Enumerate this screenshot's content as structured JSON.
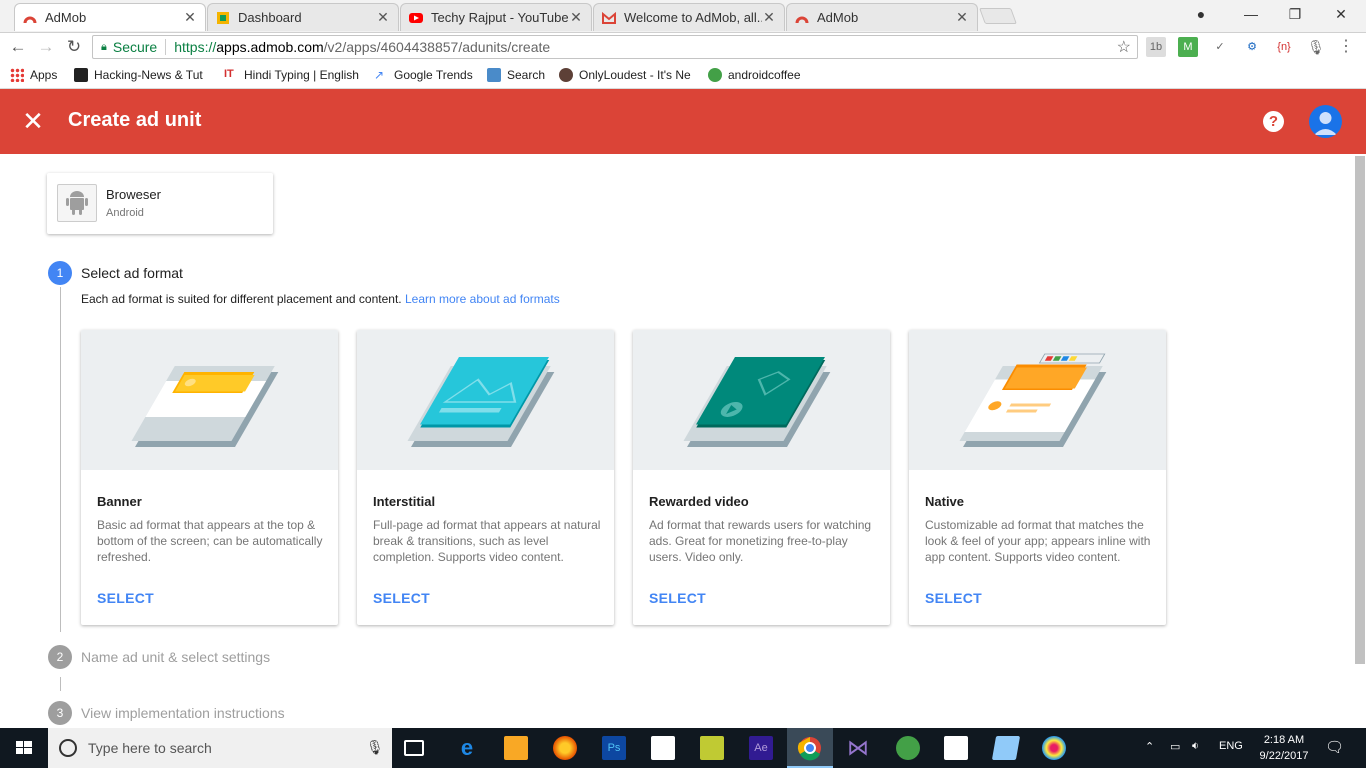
{
  "browser": {
    "tabs": [
      {
        "title": "AdMob",
        "active": true,
        "icon": "admob-icon"
      },
      {
        "title": "Dashboard",
        "active": false,
        "icon": "dashboard-icon"
      },
      {
        "title": "Techy Rajput - YouTube",
        "active": false,
        "icon": "youtube-icon"
      },
      {
        "title": "Welcome to AdMob, all...",
        "active": false,
        "icon": "gmail-icon"
      },
      {
        "title": "AdMob",
        "active": false,
        "icon": "admob-icon"
      }
    ],
    "address": {
      "secure_label": "Secure",
      "protocol": "https://",
      "host": "apps.admob.com",
      "path": "/v2/apps/4604438857/adunits/create"
    },
    "bookmarks": [
      {
        "label": "Apps",
        "icon": "apps-grid-icon"
      },
      {
        "label": "Hacking-News & Tut",
        "icon": "hacking-news-icon"
      },
      {
        "label": "Hindi Typing | English",
        "icon": "hindi-typing-icon"
      },
      {
        "label": "Google Trends",
        "icon": "trends-icon"
      },
      {
        "label": "Search",
        "icon": "search-bookmark-icon"
      },
      {
        "label": "OnlyLoudest - It's Ne",
        "icon": "onlyloudest-icon"
      },
      {
        "label": "androidcoffee",
        "icon": "android-icon"
      }
    ]
  },
  "header": {
    "title": "Create ad unit",
    "color": "#db4437"
  },
  "app": {
    "name": "Broweser",
    "platform": "Android"
  },
  "steps": [
    {
      "number": "1",
      "label": "Select ad format",
      "active": true
    },
    {
      "number": "2",
      "label": "Name ad unit & select settings",
      "active": false
    },
    {
      "number": "3",
      "label": "View implementation instructions",
      "active": false
    }
  ],
  "step1": {
    "description": "Each ad format is suited for different placement and content.",
    "learn_more": "Learn more about ad formats"
  },
  "formats": [
    {
      "name": "Banner",
      "description": "Basic ad format that appears at the top & bottom of the screen; can be automatically refreshed.",
      "action": "SELECT",
      "accent": "#ffb300"
    },
    {
      "name": "Interstitial",
      "description": "Full-page ad format that appears at natural break & transitions, such as level completion. Supports video content.",
      "action": "SELECT",
      "accent": "#26a9bc"
    },
    {
      "name": "Rewarded video",
      "description": "Ad format that rewards users for watching ads. Great for monetizing free-to-play users. Video only.",
      "action": "SELECT",
      "accent": "#00897b"
    },
    {
      "name": "Native",
      "description": "Customizable ad format that matches the look & feel of your app; appears inline with app content. Supports video content.",
      "action": "SELECT",
      "accent": "#fb8c00"
    }
  ],
  "taskbar": {
    "search_placeholder": "Type here to search",
    "language": "ENG",
    "time": "2:18 AM",
    "date": "9/22/2017"
  }
}
